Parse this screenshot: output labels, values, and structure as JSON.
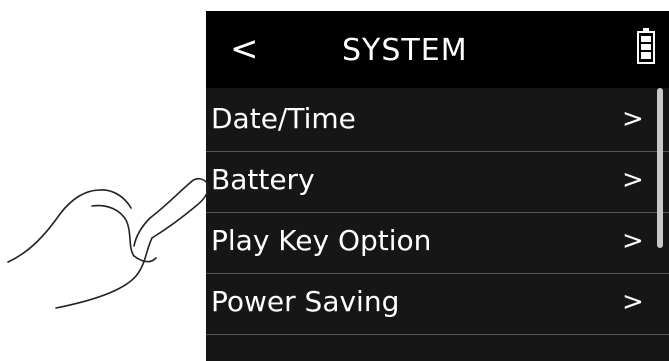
{
  "screen": {
    "header": {
      "back_icon": "chevron-left-icon",
      "title": "SYSTEM",
      "battery_icon": "battery-icon"
    },
    "menu_items": [
      {
        "label": "Date/Time",
        "icon": "chevron-right-icon"
      },
      {
        "label": "Battery",
        "icon": "chevron-right-icon"
      },
      {
        "label": "Play Key Option",
        "icon": "chevron-right-icon"
      },
      {
        "label": "Power Saving",
        "icon": "chevron-right-icon"
      }
    ],
    "colors": {
      "background": "#161616",
      "header": "#000000",
      "text": "#ffffff",
      "divider": "#555555"
    }
  },
  "illustration": {
    "icon": "pointing-hand-icon"
  }
}
